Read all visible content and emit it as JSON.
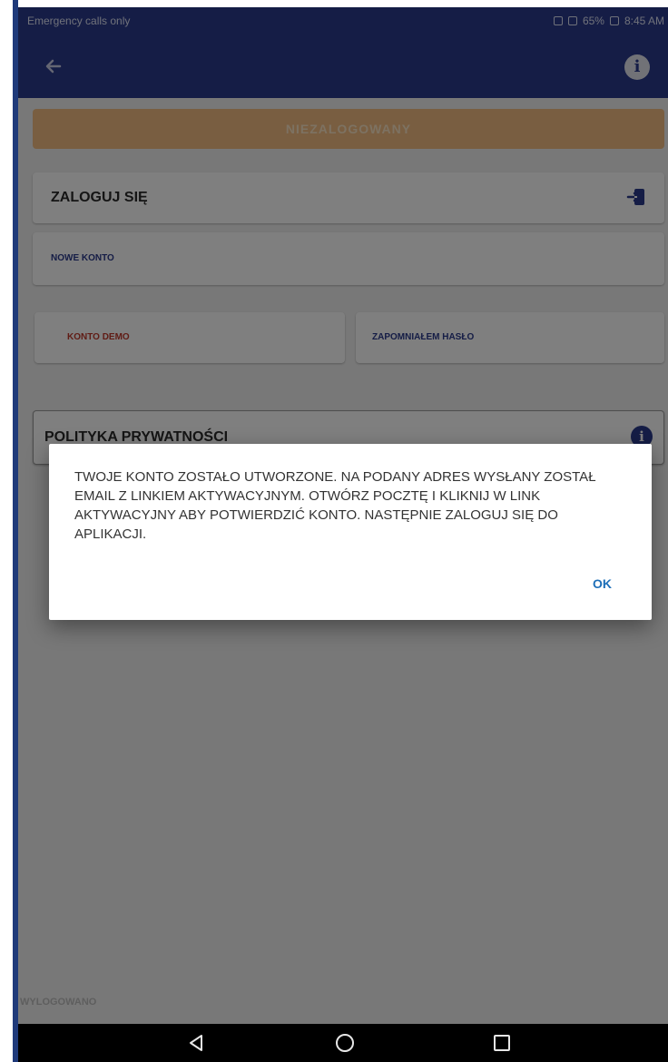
{
  "status_bar": {
    "left_text": "Emergency calls only",
    "right_text": "65%",
    "time": "8:45 AM"
  },
  "app_bar": {
    "back_icon": "arrow-back-icon",
    "info_icon": "info-icon"
  },
  "banner": {
    "label": "NIEZALOGOWANY",
    "color": "#f2bd83"
  },
  "menu": {
    "login_label": "ZALOGUJ SIĘ",
    "new_account_label": "NOWE KONTO",
    "demo_label": "KONTO DEMO",
    "forgot_label": "ZAPOMNIAŁEM HASŁO",
    "privacy_label": "POLITYKA PRYWATNOŚCI"
  },
  "footer": {
    "status": "WYLOGOWANO"
  },
  "dialog": {
    "message": "TWOJE KONTO ZOSTAŁO UTWORZONE. NA PODANY ADRES WYSŁANY ZOSTAŁ EMAIL Z LINKIEM AKTYWACYJNYM. OTWÓRZ POCZTĘ I KLIKNIJ W LINK AKTYWACYJNY ABY POTWIERDZIĆ KONTO. NASTĘPNIE ZALOGUJ SIĘ DO APLIKACJI.",
    "ok_label": "OK"
  },
  "colors": {
    "primary": "#2b3a8c",
    "accent_link": "#1e6fb8",
    "demo_text": "#c0392b"
  }
}
